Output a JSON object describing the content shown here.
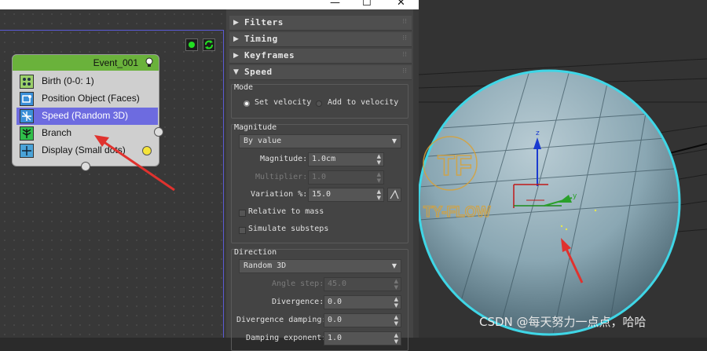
{
  "window": {
    "minimize_glyph": "—",
    "maximize_glyph": "☐",
    "close_glyph": "✕"
  },
  "node_editor": {
    "event": {
      "title": "Event_001",
      "header_color": "#6ab23b",
      "operators": [
        {
          "label": "Birth (0-0: 1)",
          "icon": "birth-icon",
          "selected": false
        },
        {
          "label": "Position Object (Faces)",
          "icon": "position-object-icon",
          "selected": false
        },
        {
          "label": "Speed (Random 3D)",
          "icon": "speed-icon",
          "selected": true
        },
        {
          "label": "Branch",
          "icon": "branch-icon",
          "selected": false
        },
        {
          "label": "Display (Small dots)",
          "icon": "display-icon",
          "selected": false
        }
      ]
    },
    "selection_color": "#6d6be0"
  },
  "panel": {
    "rollouts": [
      {
        "title": "Filters",
        "open": false
      },
      {
        "title": "Timing",
        "open": false
      },
      {
        "title": "Keyframes",
        "open": false
      },
      {
        "title": "Speed",
        "open": true
      }
    ],
    "mode": {
      "label": "Mode",
      "options": [
        "Set velocity",
        "Add to velocity"
      ],
      "selected": "Set velocity"
    },
    "magnitude": {
      "label": "Magnitude",
      "type_value": "By value",
      "fields": [
        {
          "label": "Magnitude:",
          "value": "1.0cm",
          "enabled": true
        },
        {
          "label": "Multiplier:",
          "value": "1.0",
          "enabled": false
        },
        {
          "label": "Variation %:",
          "value": "15.0",
          "enabled": true
        }
      ],
      "checkboxes": [
        "Relative to mass",
        "Simulate substeps"
      ]
    },
    "direction": {
      "label": "Direction",
      "type_value": "Random 3D",
      "fields": [
        {
          "label": "Angle step:",
          "value": "45.0",
          "enabled": false
        },
        {
          "label": "Divergence:",
          "value": "0.0",
          "enabled": true
        },
        {
          "label": "Divergence damping:",
          "value": "0.0",
          "enabled": true
        },
        {
          "label": "Damping exponent:",
          "value": "1.0",
          "enabled": true
        }
      ]
    }
  },
  "viewport": {
    "logo_text": "TY-FLOW",
    "logo_mark": "TF",
    "axis_z": "z",
    "axis_y": "y",
    "sphere_outline_color": "#3fd6e6"
  },
  "watermark": "CSDN @每天努力一点点，哈哈"
}
